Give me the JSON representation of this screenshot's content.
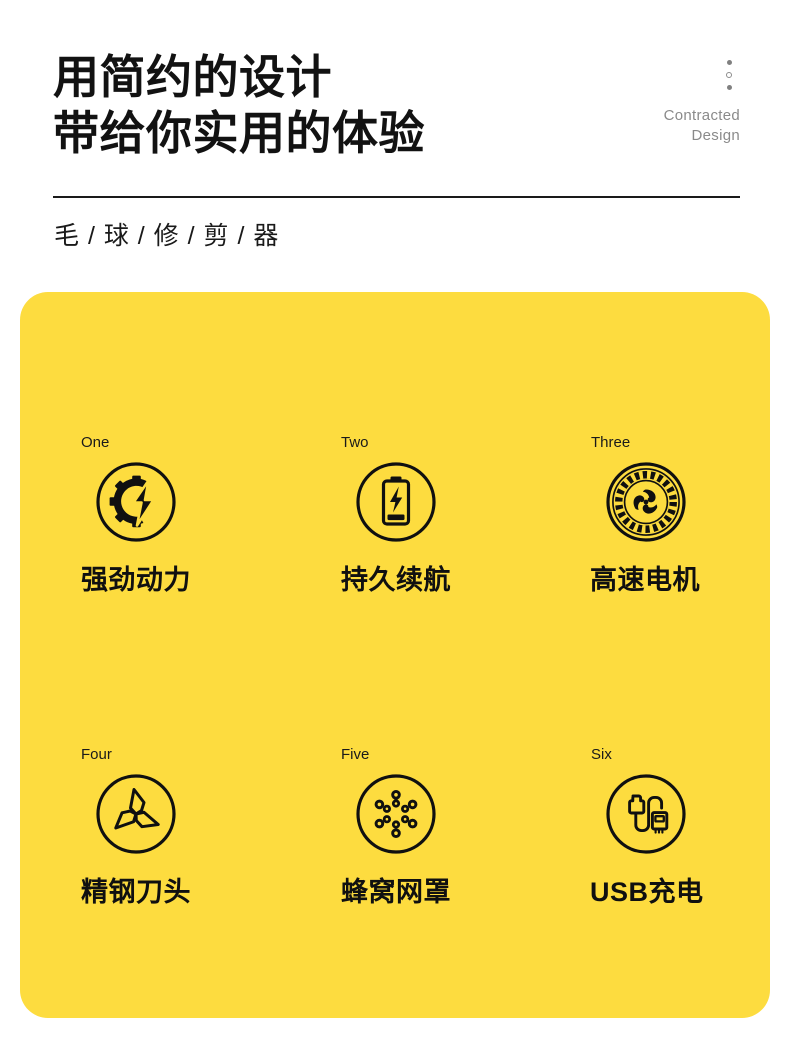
{
  "header": {
    "headline_line1": "用简约的设计",
    "headline_line2": "带给你实用的体验",
    "corner_line1": "Contracted",
    "corner_line2": "Design",
    "subtitle": "毛 / 球 / 修 / 剪 / 器"
  },
  "colors": {
    "panel_yellow": "#FDDC3F",
    "page_background": "#FFFFFF",
    "ink": "#101010",
    "muted_gray": "#8A8A8A"
  },
  "features": [
    {
      "index": "One",
      "caption": "强劲动力",
      "icon": "gear-bolt-icon"
    },
    {
      "index": "Two",
      "caption": "持久续航",
      "icon": "battery-bolt-icon"
    },
    {
      "index": "Three",
      "caption": "高速电机",
      "icon": "motor-fan-icon"
    },
    {
      "index": "Four",
      "caption": "精钢刀头",
      "icon": "rotary-blade-icon"
    },
    {
      "index": "Five",
      "caption": "蜂窝网罩",
      "icon": "honeycomb-mesh-icon"
    },
    {
      "index": "Six",
      "caption": "USB充电",
      "icon": "usb-cable-icon"
    }
  ]
}
